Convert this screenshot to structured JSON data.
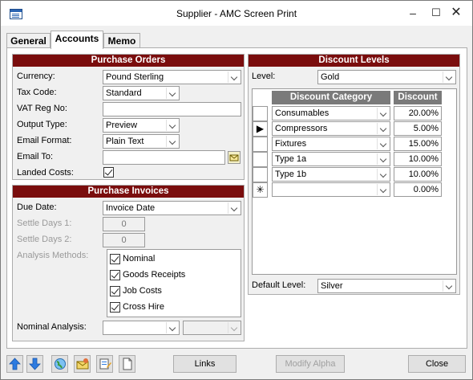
{
  "window": {
    "title": "Supplier - AMC Screen Print"
  },
  "tabs": [
    {
      "label": "General"
    },
    {
      "label": "Accounts"
    },
    {
      "label": "Memo"
    }
  ],
  "purchase_orders": {
    "heading": "Purchase Orders",
    "currency_label": "Currency:",
    "currency_value": "Pound Sterling",
    "tax_code_label": "Tax Code:",
    "tax_code_value": "Standard",
    "vat_label": "VAT Reg No:",
    "vat_value": "",
    "output_type_label": "Output Type:",
    "output_type_value": "Preview",
    "email_format_label": "Email Format:",
    "email_format_value": "Plain Text",
    "email_to_label": "Email To:",
    "email_to_value": "",
    "landed_costs_label": "Landed Costs:",
    "landed_costs_checked": true
  },
  "purchase_invoices": {
    "heading": "Purchase Invoices",
    "due_date_label": "Due Date:",
    "due_date_value": "Invoice Date",
    "settle1_label": "Settle Days 1:",
    "settle1_value": "0",
    "settle2_label": "Settle Days 2:",
    "settle2_value": "0",
    "analysis_label": "Analysis Methods:",
    "methods": [
      {
        "label": "Nominal",
        "checked": true
      },
      {
        "label": "Goods Receipts",
        "checked": true
      },
      {
        "label": "Job Costs",
        "checked": true
      },
      {
        "label": "Cross Hire",
        "checked": true
      }
    ],
    "nominal_analysis_label": "Nominal Analysis:",
    "nominal_analysis_value": "",
    "nominal_analysis_value2": ""
  },
  "discount_levels": {
    "heading": "Discount Levels",
    "level_label": "Level:",
    "level_value": "Gold",
    "columns": [
      "Discount Category",
      "Discount"
    ],
    "rows": [
      {
        "selector": "",
        "category": "Consumables",
        "discount": "20.00%"
      },
      {
        "selector": "▶",
        "category": "Compressors",
        "discount": "5.00%"
      },
      {
        "selector": "",
        "category": "Fixtures",
        "discount": "15.00%"
      },
      {
        "selector": "",
        "category": "Type 1a",
        "discount": "10.00%"
      },
      {
        "selector": "",
        "category": "Type 1b",
        "discount": "10.00%"
      },
      {
        "selector": "✳",
        "category": "",
        "discount": "0.00%"
      }
    ],
    "default_level_label": "Default Level:",
    "default_level_value": "Silver"
  },
  "footer": {
    "nav_icons": [
      "arrow-up-icon",
      "arrow-down-icon",
      "globe-icon",
      "envelope-icon",
      "document-edit-icon",
      "blank-page-icon"
    ],
    "links_label": "Links",
    "modify_alpha_label": "Modify Alpha",
    "close_label": "Close"
  },
  "colors": {
    "section_header": "#7a0d0d",
    "grid_header": "#7a7a7a"
  }
}
